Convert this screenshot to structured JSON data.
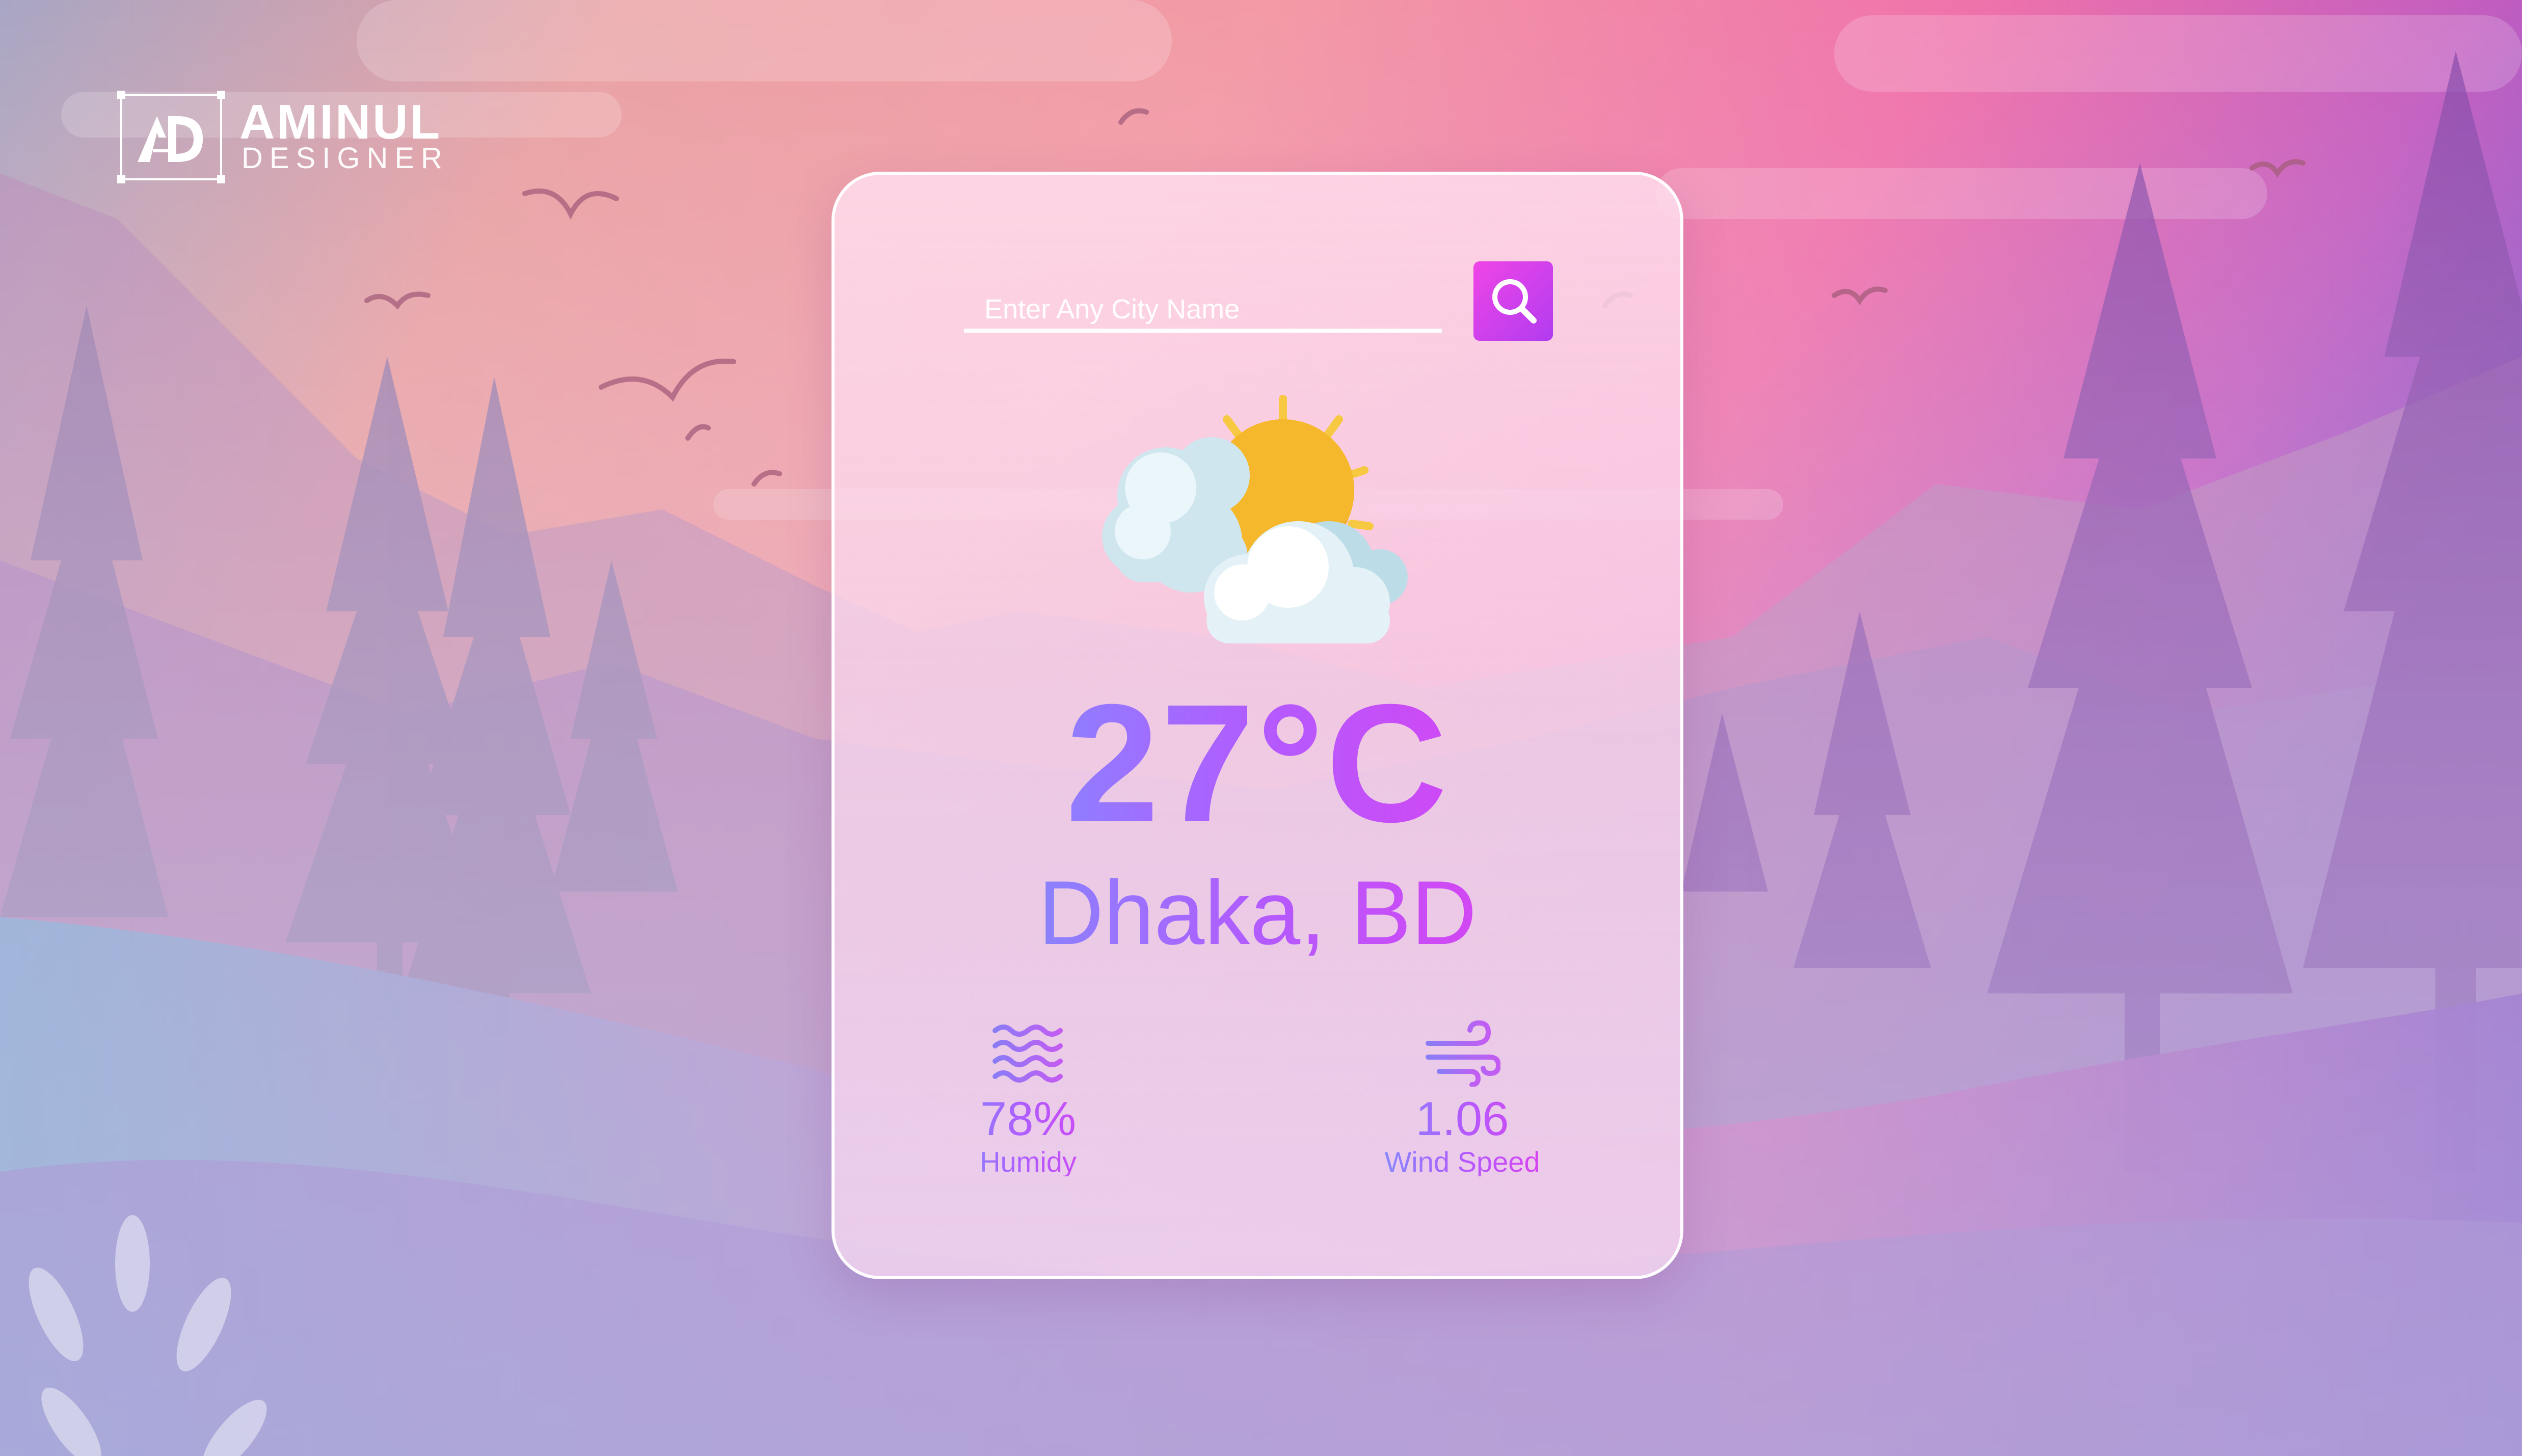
{
  "brand": {
    "name": "AMINUL",
    "subtitle": "DESIGNER"
  },
  "search": {
    "placeholder": "Enter Any City Name",
    "value": "",
    "button_icon": "search-icon"
  },
  "weather": {
    "icon": "partly-cloudy-sun-icon",
    "temperature": "27°C",
    "city": "Dhaka, BD",
    "humidity": {
      "icon": "humidity-waves-icon",
      "value": "78%",
      "label": "Humidy"
    },
    "wind": {
      "icon": "wind-icon",
      "value": "1.06",
      "label": "Wind Speed"
    }
  },
  "colors": {
    "gradient_start": "#66a7ff",
    "gradient_mid": "#b25bff",
    "gradient_end": "#f034e8",
    "search_button": "#d63ff0",
    "sun": "#f7c943",
    "cloud": "#d8eef5"
  }
}
